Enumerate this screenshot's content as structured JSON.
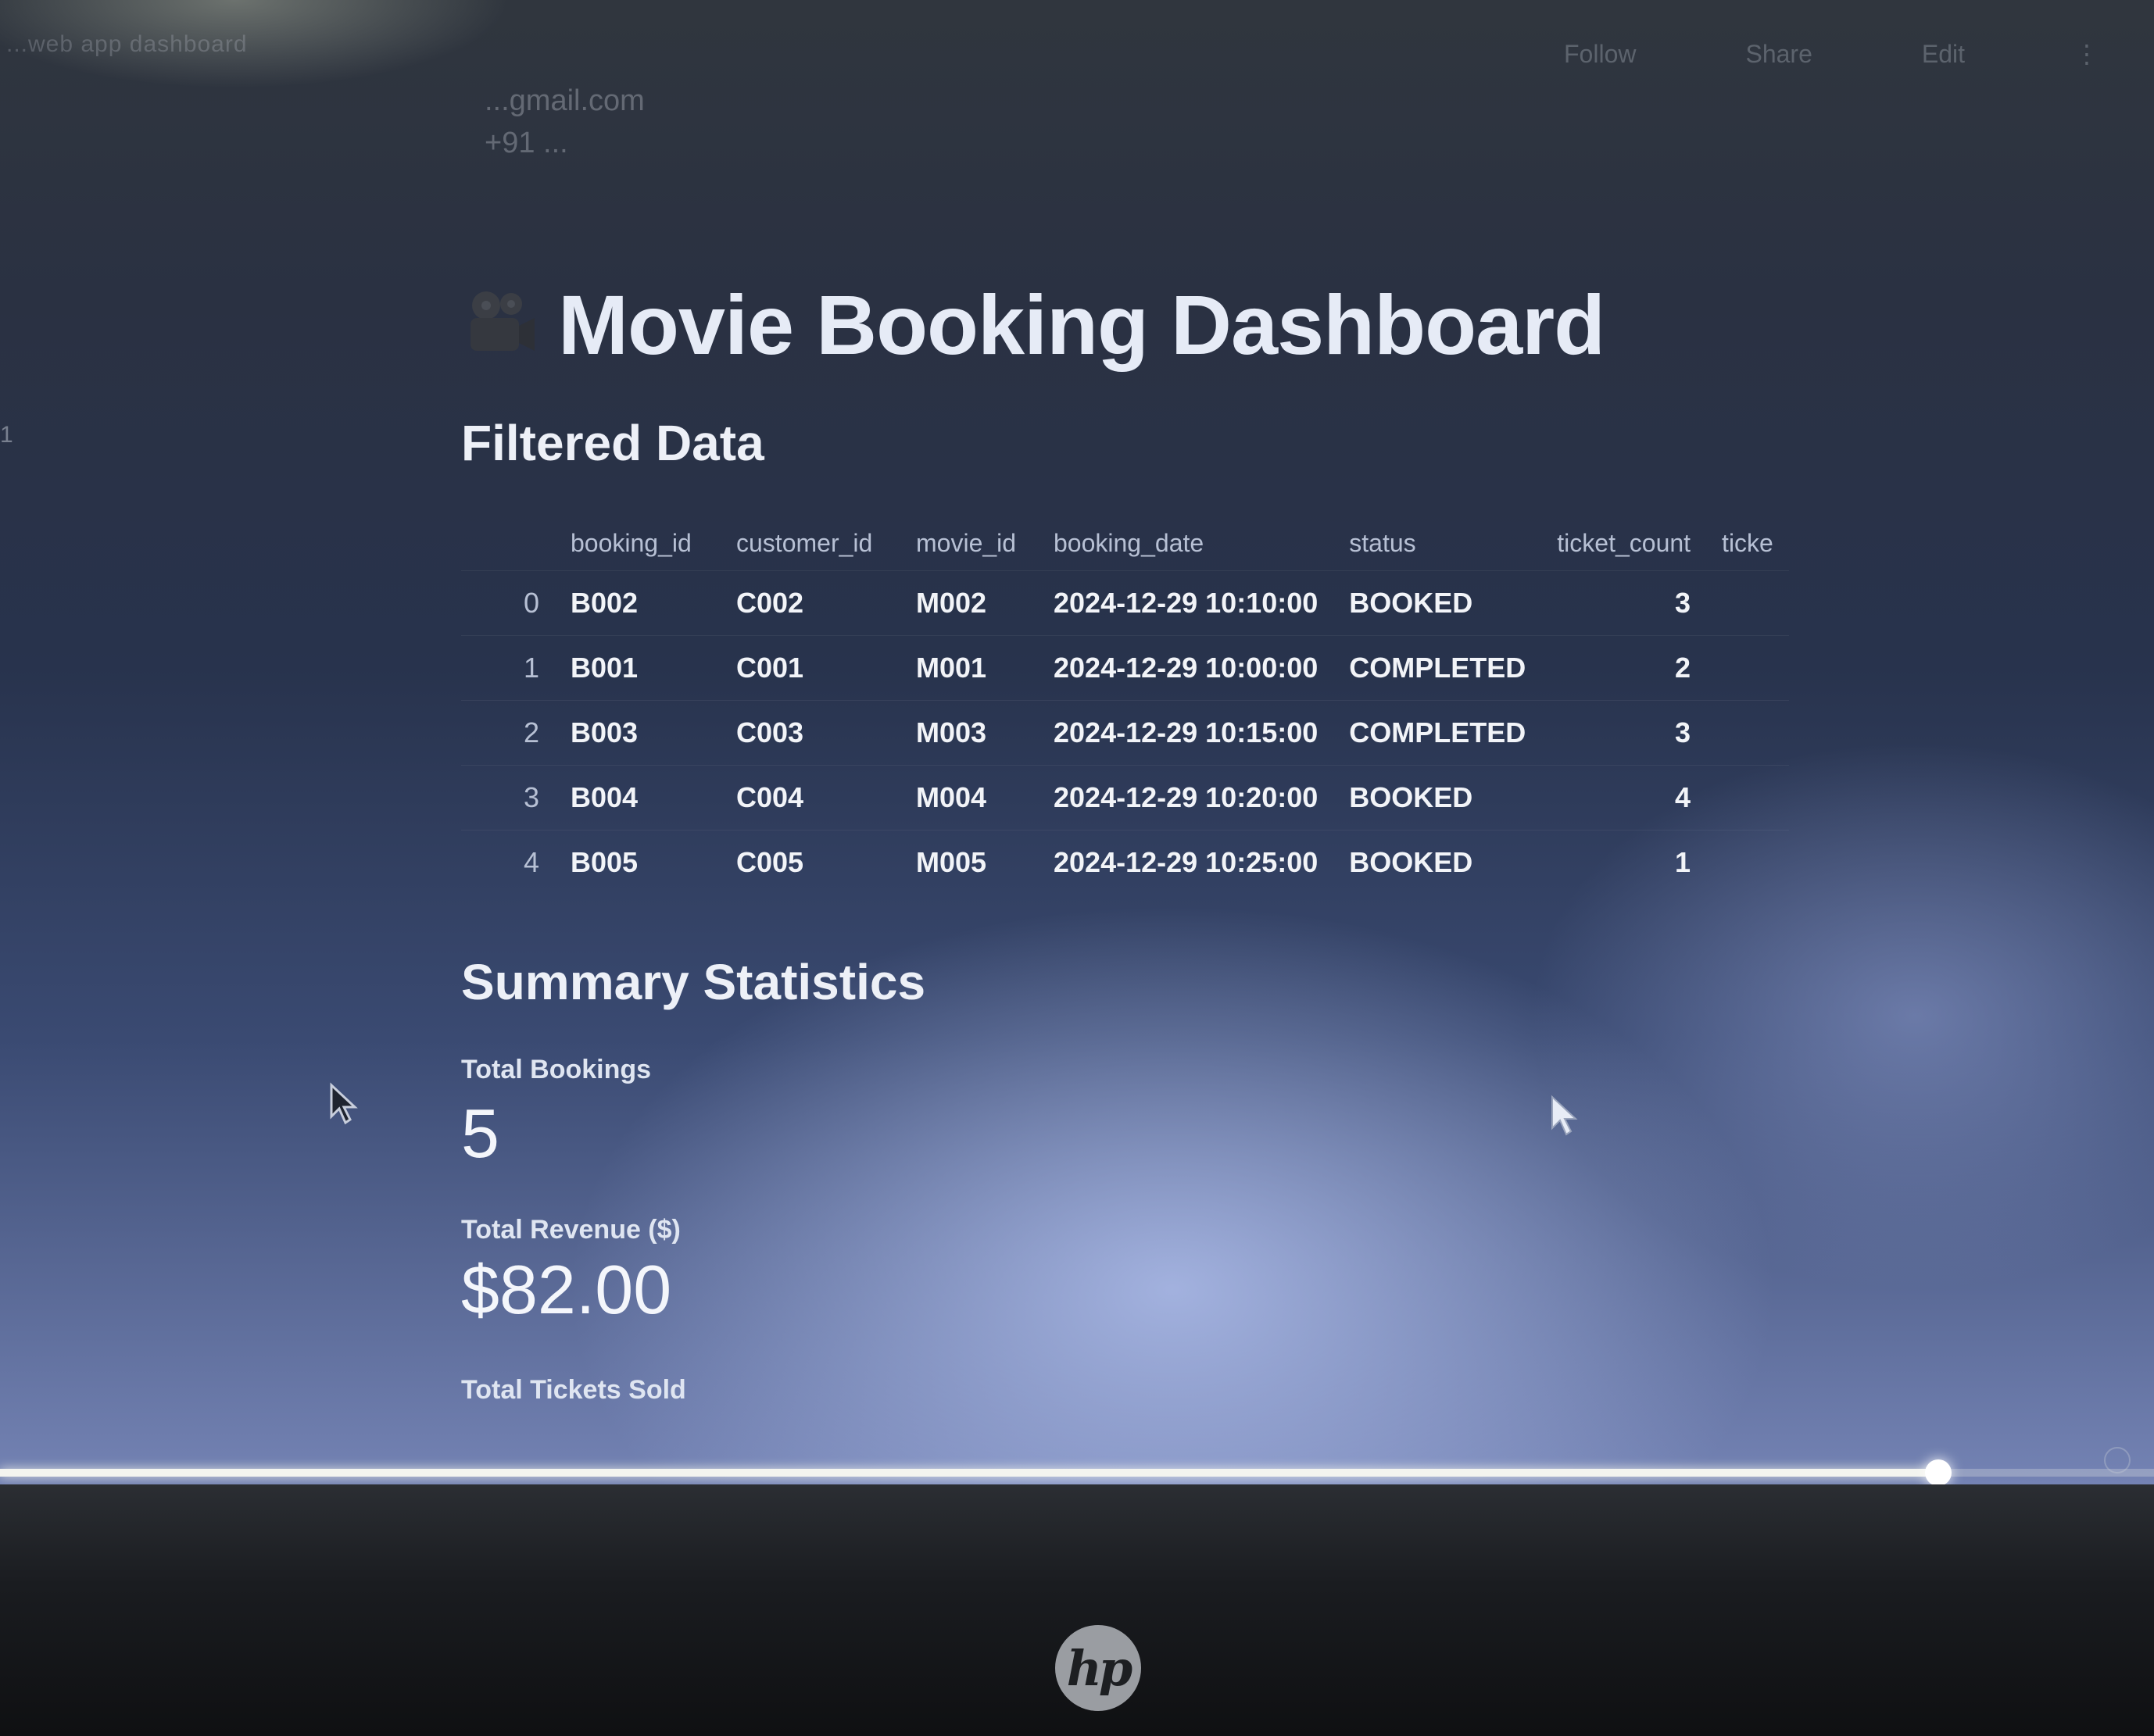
{
  "window": {
    "title": "...web app dashboard"
  },
  "topbar": {
    "actions": [
      "Follow",
      "Share",
      "Edit"
    ]
  },
  "contact": {
    "email": "...gmail.com",
    "phone": "+91 ..."
  },
  "page_title": "Movie Booking Dashboard",
  "filtered": {
    "heading": "Filtered Data",
    "columns": [
      "booking_id",
      "customer_id",
      "movie_id",
      "booking_date",
      "status",
      "ticket_count",
      "ticke"
    ],
    "rows": [
      {
        "idx": "0",
        "booking_id": "B002",
        "customer_id": "C002",
        "movie_id": "M002",
        "booking_date": "2024-12-29 10:10:00",
        "status": "BOOKED",
        "ticket_count": "3"
      },
      {
        "idx": "1",
        "booking_id": "B001",
        "customer_id": "C001",
        "movie_id": "M001",
        "booking_date": "2024-12-29 10:00:00",
        "status": "COMPLETED",
        "ticket_count": "2"
      },
      {
        "idx": "2",
        "booking_id": "B003",
        "customer_id": "C003",
        "movie_id": "M003",
        "booking_date": "2024-12-29 10:15:00",
        "status": "COMPLETED",
        "ticket_count": "3"
      },
      {
        "idx": "3",
        "booking_id": "B004",
        "customer_id": "C004",
        "movie_id": "M004",
        "booking_date": "2024-12-29 10:20:00",
        "status": "BOOKED",
        "ticket_count": "4"
      },
      {
        "idx": "4",
        "booking_id": "B005",
        "customer_id": "C005",
        "movie_id": "M005",
        "booking_date": "2024-12-29 10:25:00",
        "status": "BOOKED",
        "ticket_count": "1"
      }
    ]
  },
  "summary": {
    "heading": "Summary Statistics",
    "total_bookings_label": "Total Bookings",
    "total_bookings_value": "5",
    "total_revenue_label": "Total Revenue ($)",
    "total_revenue_value": "$82.00",
    "total_tickets_label": "Total Tickets Sold"
  },
  "video_progress": {
    "fraction": 0.9
  },
  "brand": {
    "logo_text": "hp"
  },
  "icons": {
    "title_icon": "film-camera-icon",
    "cursor": "mouse-pointer-icon"
  },
  "colors": {
    "title": "#e6ebf6",
    "text": "#f2f4f8",
    "header_text": "#b7c0d4"
  }
}
